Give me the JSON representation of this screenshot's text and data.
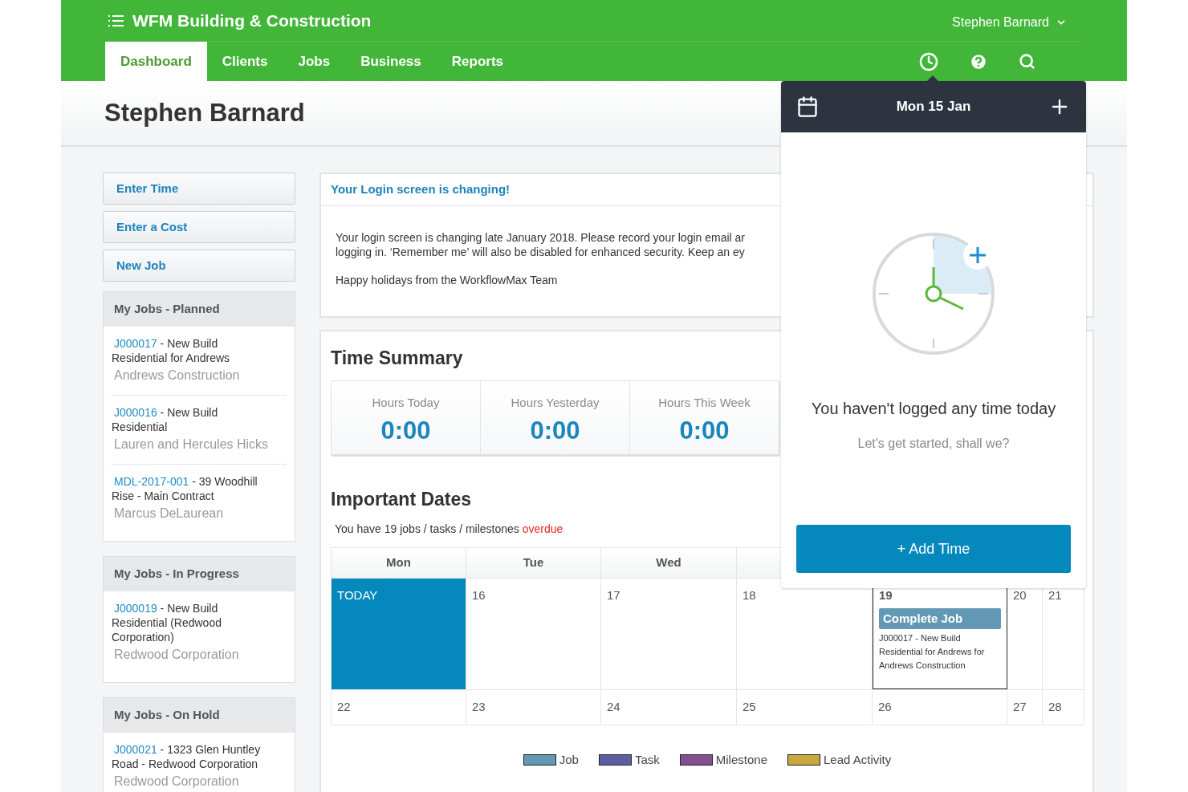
{
  "app": {
    "title": "WFM Building & Construction",
    "user": "Stephen Barnard"
  },
  "nav_tabs": [
    {
      "label": "Dashboard",
      "selected": true
    },
    {
      "label": "Clients",
      "selected": false
    },
    {
      "label": "Jobs",
      "selected": false
    },
    {
      "label": "Business",
      "selected": false
    },
    {
      "label": "Reports",
      "selected": false
    }
  ],
  "page_title": "Stephen Barnard",
  "quick_actions": [
    "Enter Time",
    "Enter a Cost",
    "New Job"
  ],
  "job_sections": [
    {
      "title": "My Jobs - Planned",
      "jobs": [
        {
          "code": "J000017",
          "description": " - New Build Residential for Andrews",
          "client": "Andrews Construction"
        },
        {
          "code": "J000016",
          "description": " - New Build Residential",
          "client": "Lauren and Hercules Hicks"
        },
        {
          "code": "MDL-2017-001",
          "description": " - 39 Woodhill Rise - Main Contract",
          "client": "Marcus DeLaurean"
        }
      ]
    },
    {
      "title": "My Jobs - In Progress",
      "jobs": [
        {
          "code": "J000019",
          "description": " - New Build Residential (Redwood Corporation)",
          "client": "Redwood Corporation"
        }
      ]
    },
    {
      "title": "My Jobs - On Hold",
      "jobs": [
        {
          "code": "J000021",
          "description": " - 1323 Glen Huntley Road - Redwood Corporation",
          "client": "Redwood Corporation"
        }
      ]
    }
  ],
  "notice": {
    "title": "Your Login screen is changing!",
    "lines": [
      "Your login screen is changing late January 2018. Please record your login email ar",
      "logging in. ‘Remember me’ will also be disabled for enhanced security. Keep an ey"
    ],
    "signoff": "Happy holidays from the WorkflowMax Team"
  },
  "time_summary": {
    "title": "Time Summary",
    "stats": [
      {
        "label": "Hours Today",
        "value": "0:00"
      },
      {
        "label": "Hours Yesterday",
        "value": "0:00"
      },
      {
        "label": "Hours This Week",
        "value": "0:00"
      }
    ]
  },
  "important_dates": {
    "title": "Important Dates",
    "message": "You have 19 jobs / tasks / milestones",
    "highlight": "overdue"
  },
  "calendar": {
    "headers": [
      "Mon",
      "Tue",
      "Wed"
    ],
    "weeks": [
      [
        {
          "label": "TODAY",
          "today": true,
          "outlined": false
        },
        {
          "label": "16",
          "today": false,
          "outlined": false
        },
        {
          "label": "17",
          "today": false,
          "outlined": false
        },
        {
          "label": "18",
          "today": false,
          "outlined": false
        },
        {
          "label": "19",
          "today": false,
          "outlined": true,
          "events": [
            {
              "title": "Complete Job",
              "detail": "J000017 - New Build Residential for Andrews for Andrews Construction",
              "color": "#6399b4"
            }
          ]
        },
        {
          "label": "20",
          "today": false,
          "outlined": false
        },
        {
          "label": "21",
          "today": false,
          "outlined": false
        }
      ],
      [
        {
          "label": "22",
          "today": false,
          "outlined": false
        },
        {
          "label": "23",
          "today": false,
          "outlined": false
        },
        {
          "label": "24",
          "today": false,
          "outlined": false
        },
        {
          "label": "25",
          "today": false,
          "outlined": false
        },
        {
          "label": "26",
          "today": false,
          "outlined": false
        },
        {
          "label": "27",
          "today": false,
          "outlined": false
        },
        {
          "label": "28",
          "today": false,
          "outlined": false
        }
      ]
    ]
  },
  "legend": [
    {
      "label": "Job",
      "color": "#6399b4"
    },
    {
      "label": "Task",
      "color": "#5b5fa0"
    },
    {
      "label": "Milestone",
      "color": "#834f91"
    },
    {
      "label": "Lead Activity",
      "color": "#c9a83e"
    }
  ],
  "time_popup": {
    "date": "Mon 15 Jan",
    "message": "You haven't logged any time today",
    "prompt": "Let's get started, shall we?",
    "button": "+ Add Time"
  }
}
